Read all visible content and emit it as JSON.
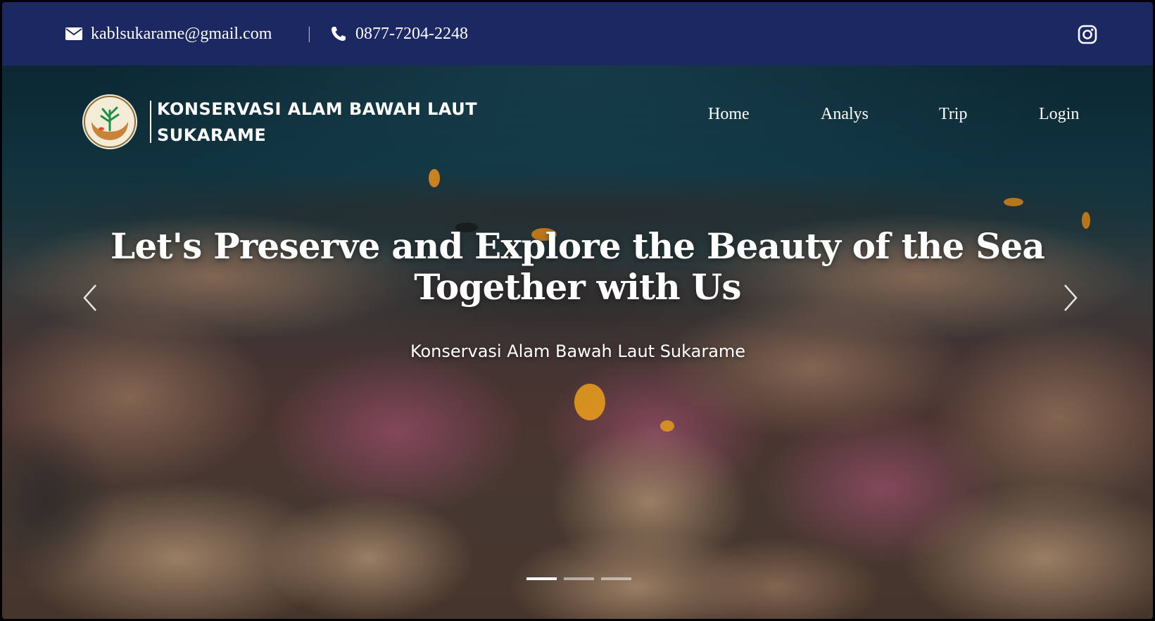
{
  "topbar": {
    "email": "kablsukarame@gmail.com",
    "separator": "|",
    "phone": "0877-7204-2248",
    "icons": {
      "email": "envelope-icon",
      "phone": "phone-icon",
      "social": "instagram-icon"
    }
  },
  "brand": {
    "name_line1": "KONSERVASI ALAM BAWAH LAUT",
    "name_line2": "SUKARAME"
  },
  "nav": {
    "items": [
      {
        "label": "Home"
      },
      {
        "label": "Analys"
      },
      {
        "label": "Trip"
      },
      {
        "label": "Login"
      }
    ]
  },
  "hero": {
    "headline_line1": "Let's Preserve and Explore the Beauty of the Sea",
    "headline_line2": "Together with Us",
    "subtitle": "Konservasi Alam Bawah Laut Sukarame",
    "slide_count": 3,
    "active_slide": 1
  },
  "colors": {
    "topbar_bg": "#1b2862",
    "text": "#ffffff"
  }
}
